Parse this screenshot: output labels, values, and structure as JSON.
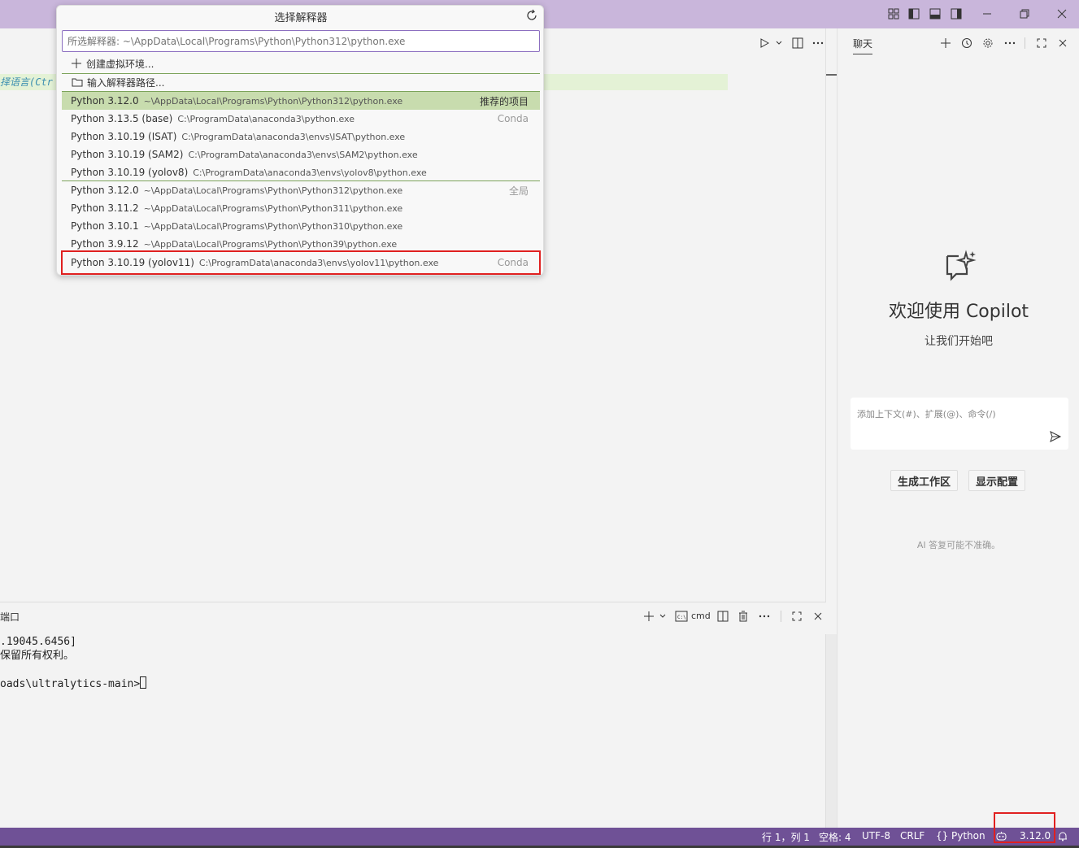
{
  "quick_pick": {
    "title": "选择解释器",
    "input_placeholder": "所选解释器: ~\\AppData\\Local\\Programs\\Python\\Python312\\python.exe",
    "actions": [
      {
        "label": "创建虚拟环境...",
        "icon": "plus-icon"
      },
      {
        "label": "输入解释器路径...",
        "icon": "folder-icon"
      }
    ],
    "items": [
      {
        "label": "Python 3.12.0",
        "desc": "~\\AppData\\Local\\Programs\\Python\\Python312\\python.exe",
        "tag": "推荐的项目",
        "selected": true
      },
      {
        "label": "Python 3.13.5 (base)",
        "desc": "C:\\ProgramData\\anaconda3\\python.exe",
        "tag": "Conda"
      },
      {
        "label": "Python 3.10.19 (ISAT)",
        "desc": "C:\\ProgramData\\anaconda3\\envs\\ISAT\\python.exe",
        "tag": ""
      },
      {
        "label": "Python 3.10.19 (SAM2)",
        "desc": "C:\\ProgramData\\anaconda3\\envs\\SAM2\\python.exe",
        "tag": ""
      },
      {
        "label": "Python 3.10.19 (yolov8)",
        "desc": "C:\\ProgramData\\anaconda3\\envs\\yolov8\\python.exe",
        "tag": ""
      },
      {
        "label": "Python 3.12.0",
        "desc": "~\\AppData\\Local\\Programs\\Python\\Python312\\python.exe",
        "tag": "全局"
      },
      {
        "label": "Python 3.11.2",
        "desc": "~\\AppData\\Local\\Programs\\Python\\Python311\\python.exe",
        "tag": ""
      },
      {
        "label": "Python 3.10.1",
        "desc": "~\\AppData\\Local\\Programs\\Python\\Python310\\python.exe",
        "tag": ""
      },
      {
        "label": "Python 3.9.12",
        "desc": "~\\AppData\\Local\\Programs\\Python\\Python39\\python.exe",
        "tag": ""
      },
      {
        "label": "Python 3.10.19 (yolov11)",
        "desc": "C:\\ProgramData\\anaconda3\\envs\\yolov11\\python.exe",
        "tag": "Conda"
      }
    ]
  },
  "editor": {
    "code_hint": "择语言(Ctr"
  },
  "panel": {
    "title": "端口",
    "shell_label": "cmd",
    "terminal_lines": [
      ".19045.6456]",
      "保留所有权利。",
      "",
      "oads\\ultralytics-main>"
    ]
  },
  "chat": {
    "tab_label": "聊天",
    "welcome_title": "欢迎使用 Copilot",
    "welcome_sub": "让我们开始吧",
    "input_placeholder": "添加上下文(#)、扩展(@)、命令(/)",
    "buttons": [
      "生成工作区",
      "显示配置"
    ],
    "ai_note": "AI 答复可能不准确。"
  },
  "statusbar": {
    "position": "行 1，列 1",
    "spaces": "空格: 4",
    "encoding": "UTF-8",
    "eol": "CRLF",
    "language": "Python",
    "interpreter_version": "3.12.0"
  },
  "colors": {
    "titlebar": "#c9b6db",
    "statusbar": "#6f5196",
    "selection": "#c8dcae",
    "highlight": "#e02020"
  }
}
